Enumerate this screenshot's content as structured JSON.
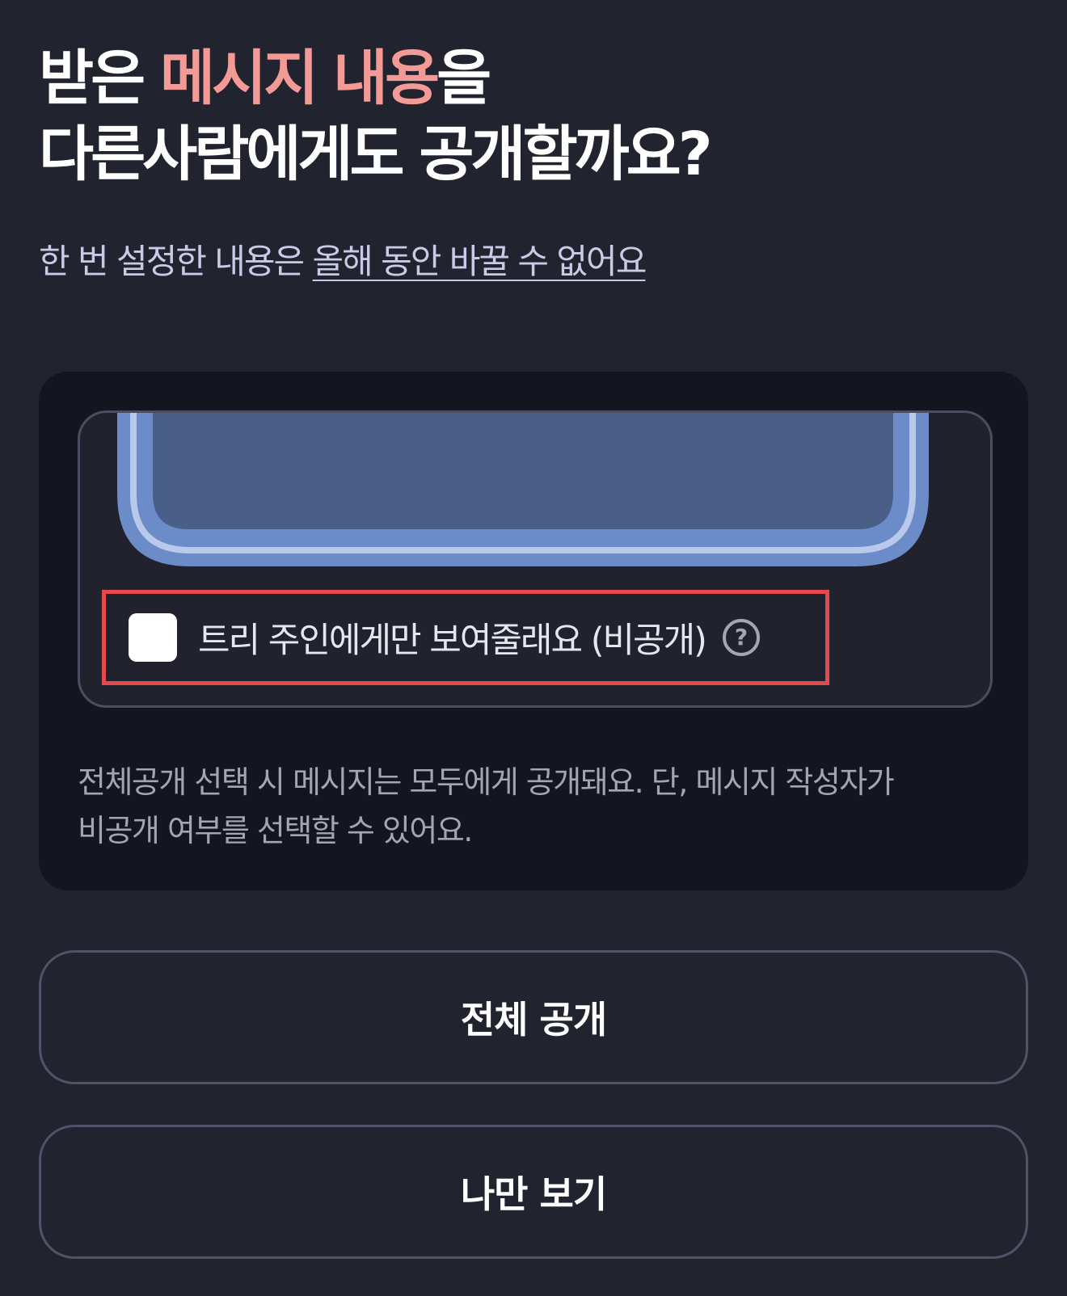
{
  "header": {
    "title_line1_prefix": "받은 ",
    "title_line1_highlight": "메시지 내용",
    "title_line1_suffix": "을",
    "title_line2": "다른사람에게도 공개할까요?",
    "subtitle_prefix": "한 번 설정한 내용은 ",
    "subtitle_link": "올해 동안 바꿀 수 없어요"
  },
  "card": {
    "private_option_label": "트리 주인에게만 보여줄래요 (비공개)",
    "checkbox_checked": false,
    "help_icon": "question-circle-icon",
    "notice_line1": "전체공개 선택 시 메시지는 모두에게 공개돼요. 단, 메시지 작성자가",
    "notice_line2": "비공개 여부를 선택할 수 있어요."
  },
  "buttons": {
    "public_label": "전체 공개",
    "private_label": "나만 보기"
  },
  "colors": {
    "background": "#21232f",
    "card_background": "#13161e",
    "highlight": "#f39a97",
    "outline_red": "#e5484d",
    "preview_blue": "#6c8bc9",
    "preview_fill": "#4a5f88"
  }
}
